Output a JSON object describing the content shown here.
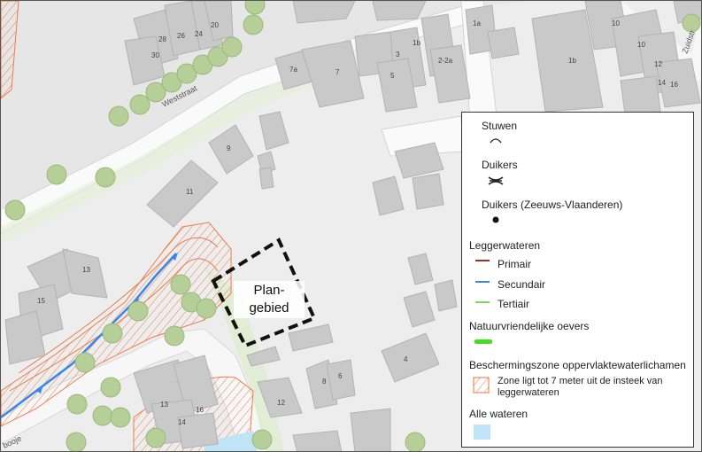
{
  "map": {
    "street_labels": [
      "Weststraat",
      "Zuidstr",
      "booje"
    ],
    "house_numbers": [
      "28",
      "26",
      "24",
      "20",
      "30",
      "7a",
      "7",
      "3",
      "1b",
      "2-2a",
      "5",
      "1a",
      "10",
      "1b",
      "10",
      "12",
      "14",
      "16",
      "9",
      "11",
      "13",
      "15",
      "13",
      "16",
      "14",
      "12",
      "8",
      "6",
      "4"
    ],
    "plan_label_line1": "Plan-",
    "plan_label_line2": "gebied"
  },
  "legend": {
    "stuwen": "Stuwen",
    "duikers": "Duikers",
    "duikers_zv": "Duikers (Zeeuws-Vlaanderen)",
    "leggerwateren": "Leggerwateren",
    "primair": "Primair",
    "secundair": "Secundair",
    "tertiair": "Tertiair",
    "natuurvriendelijke": "Natuurvriendelijke oevers",
    "bescherming": "Beschermingszone oppervlaktewaterlichamen",
    "zone_line1": "Zone ligt tot 7 meter uit de insteek van",
    "zone_line2": "leggerwateren",
    "alle_wateren": "Alle wateren"
  },
  "colors": {
    "primair": "#8b3a1e",
    "secundair": "#3a86e8",
    "tertiair": "#7fd85a",
    "natuur": "#44dd22",
    "zone": "#e8703a",
    "wateren": "#bfe4f5",
    "building": "#c9c9c9",
    "tree": "#b6cf99"
  }
}
